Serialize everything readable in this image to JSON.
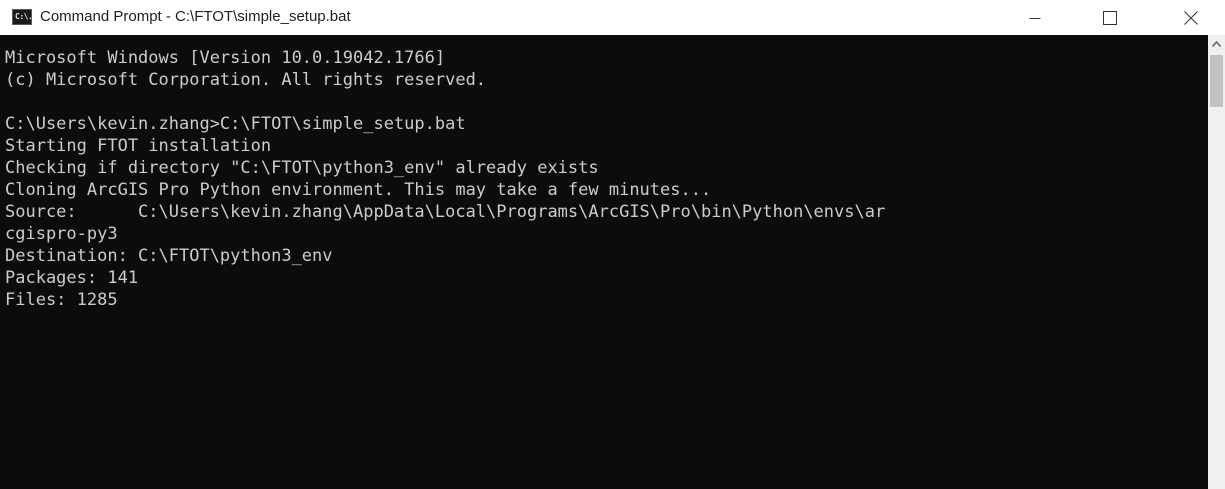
{
  "window": {
    "title": "Command Prompt - C:\\FTOT\\simple_setup.bat",
    "app_icon": "cmd-icon",
    "app_icon_text": "C:\\.",
    "controls": [
      "minimize-icon",
      "maximize-icon",
      "close-icon"
    ]
  },
  "console": {
    "lines": [
      "Microsoft Windows [Version 10.0.19042.1766]",
      "(c) Microsoft Corporation. All rights reserved.",
      "",
      "C:\\Users\\kevin.zhang>C:\\FTOT\\simple_setup.bat",
      "Starting FTOT installation",
      "Checking if directory \"C:\\FTOT\\python3_env\" already exists",
      "Cloning ArcGIS Pro Python environment. This may take a few minutes...",
      "Source:      C:\\Users\\kevin.zhang\\AppData\\Local\\Programs\\ArcGIS\\Pro\\bin\\Python\\envs\\ar",
      "cgispro-py3",
      "Destination: C:\\FTOT\\python3_env",
      "Packages: 141",
      "Files: 1285"
    ]
  },
  "colors": {
    "console_background": "#0c0c0c",
    "console_text": "#cccccc",
    "titlebar": "#ffffff"
  }
}
